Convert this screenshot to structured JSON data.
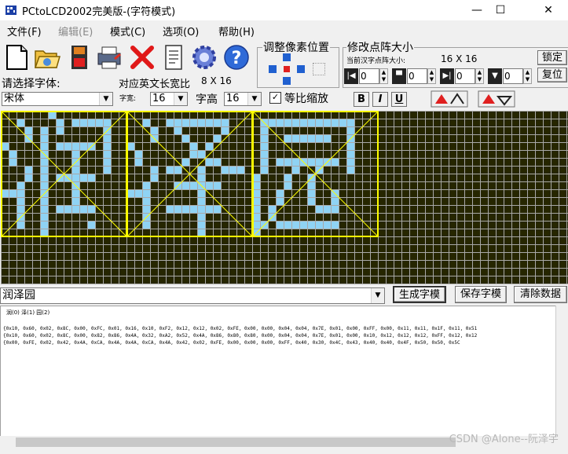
{
  "window": {
    "title": "PCtoLCD2002完美版-(字符模式)",
    "minimize_glyph": "—",
    "maximize_glyph": "☐",
    "close_glyph": "✕"
  },
  "menu": [
    {
      "label": "文件(F)",
      "enabled": true
    },
    {
      "label": "编辑(E)",
      "enabled": false
    },
    {
      "label": "模式(C)",
      "enabled": true
    },
    {
      "label": "选项(O)",
      "enabled": true
    },
    {
      "label": "帮助(H)",
      "enabled": true
    }
  ],
  "toolbar_icons": [
    "new-file-icon",
    "open-folder-icon",
    "save-disk-icon",
    "print-icon",
    "delete-x-icon",
    "notes-icon",
    "settings-gear-icon",
    "help-icon"
  ],
  "pixel_adjust": {
    "title": "调整像素位置"
  },
  "matrix_size": {
    "title": "修改点阵大小",
    "current_label": "当前汉字点阵大小:",
    "current_value": "16 X 16",
    "lock_label": "锁定",
    "reset_label": "复位",
    "spinners": [
      "0",
      "0",
      "0",
      "0"
    ]
  },
  "font": {
    "select_label": "请选择字体:",
    "font_name": "宋体",
    "ratio_label": "对应英文长宽比",
    "ratio_value": "8 X 16",
    "width_label": "字宽:",
    "width_value": "16",
    "height_label": "字高",
    "height_value": "16",
    "keep_ratio_label": "等比缩放",
    "keep_ratio_checked": true,
    "bold": "B",
    "italic": "I",
    "underline": "U"
  },
  "input": {
    "text": "润泽园",
    "generate_label": "生成字模",
    "save_label": "保存字模",
    "clear_label": "清除数据"
  },
  "output": {
    "header": "润(0) 泽(1) 园(2)",
    "lines": [
      "{0x10, 0x60, 0x02, 0x8C, 0x00, 0xFC, 0x01, 0x16, 0x10, 0xF2, 0x12, 0x12, 0x02, 0xFE, 0x00, 0x00, 0x04, 0x04, 0x7E, 0x01, 0x00, 0xFF, 0x00, 0x11, 0x11, 0x1F, 0x11, 0x51",
      "{0x10, 0x60, 0x02, 0x8C, 0x00, 0x82, 0x86, 0x4A, 0x32, 0xA2, 0x52, 0x4A, 0x86, 0x80, 0x80, 0x00, 0x04, 0x04, 0x7E, 0x01, 0x00, 0x10, 0x12, 0x12, 0x12, 0xFF, 0x12, 0x12",
      "{0x00, 0xFE, 0x02, 0x42, 0x4A, 0xCA, 0x4A, 0x4A, 0xCA, 0x4A, 0x42, 0x02, 0xFE, 0x00, 0x00, 0x00, 0xFF, 0x40, 0x30, 0x4C, 0x43, 0x40, 0x40, 0x4F, 0x50, 0x50, 0x5C"
    ]
  },
  "watermark": "CSDN @Alone--阮泽宇",
  "colors": {
    "grid_background": "#262600",
    "pixel_on": "#8fd3f4",
    "glyph_frame": "#ffff00"
  }
}
